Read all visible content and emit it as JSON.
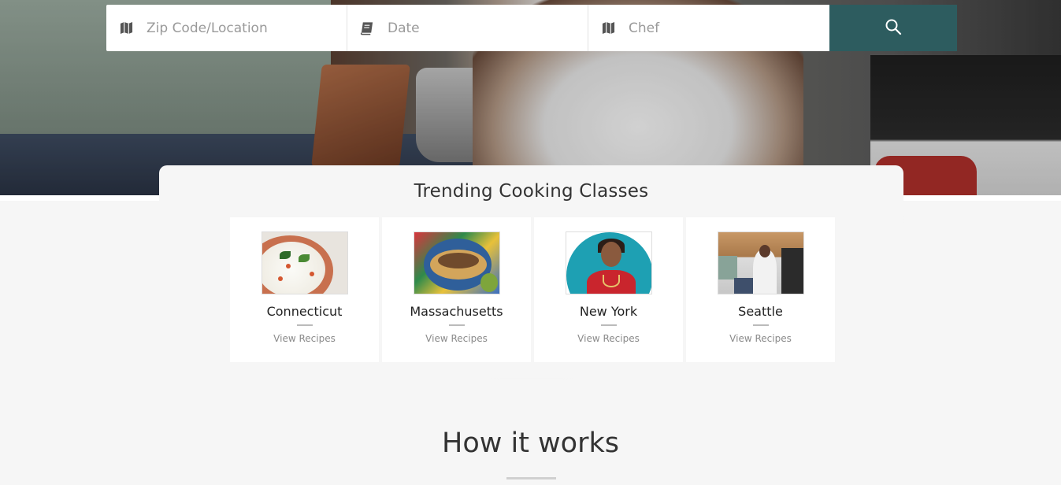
{
  "search": {
    "zip_placeholder": "Zip Code/Location",
    "date_placeholder": "Date",
    "chef_placeholder": "Chef",
    "zip_icon": "map-icon",
    "date_icon": "book-icon",
    "chef_icon": "map-icon",
    "button_icon": "search-icon"
  },
  "trending": {
    "title": "Trending Cooking Classes",
    "items": [
      {
        "name": "Connecticut",
        "link": "View Recipes",
        "image": "rice-dish-photo"
      },
      {
        "name": "Massachusetts",
        "link": "View Recipes",
        "image": "tacos-photo"
      },
      {
        "name": "New York",
        "link": "View Recipes",
        "image": "chef-portrait-photo"
      },
      {
        "name": "Seattle",
        "link": "View Recipes",
        "image": "kitchen-chef-photo"
      }
    ]
  },
  "how_it_works": {
    "title": "How it works"
  },
  "colors": {
    "accent": "#2d5c5f",
    "background": "#f6f6f6"
  }
}
